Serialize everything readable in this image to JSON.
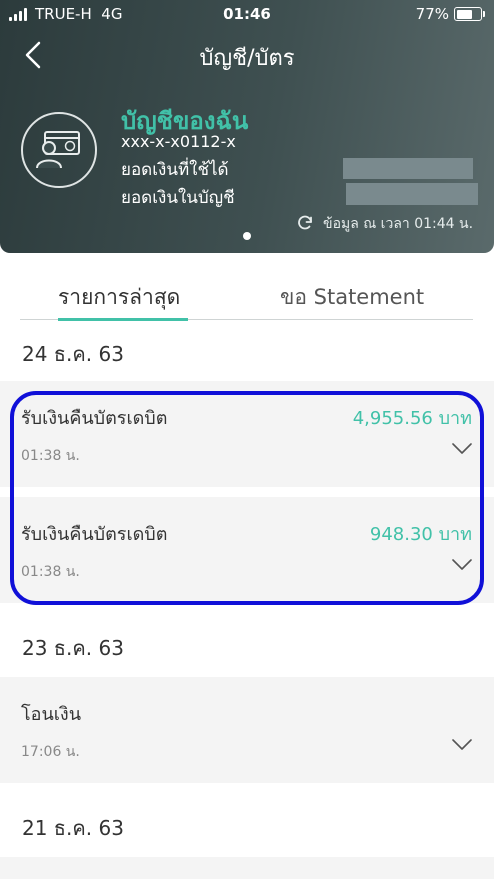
{
  "status_bar": {
    "carrier": "TRUE-H",
    "network": "4G",
    "time": "01:46",
    "battery_percent": "77%",
    "battery_level": 0.77
  },
  "header": {
    "title": "บัญชี/บัตร",
    "back_icon": "chevron-left-icon"
  },
  "account": {
    "name": "บัญชีของฉัน",
    "number": "xxx-x-x0112-x",
    "available_label": "ยอดเงินที่ใช้ได้",
    "balance_label": "ยอดเงินในบัญชี",
    "updated_at": "ข้อมูล ณ เวลา 01:44 น.",
    "icon": "account-card-user-icon"
  },
  "tabs": [
    {
      "label": "รายการล่าสุด",
      "active": true
    },
    {
      "label": "ขอ Statement",
      "active": false
    }
  ],
  "groups": [
    {
      "date": "24 ธ.ค. 63",
      "transactions": [
        {
          "name": "รับเงินคืนบัตรเดบิต",
          "amount": "4,955.56 บาท",
          "time": "01:38 น."
        },
        {
          "name": "รับเงินคืนบัตรเดบิต",
          "amount": "948.30 บาท",
          "time": "01:38 น."
        }
      ]
    },
    {
      "date": "23 ธ.ค. 63",
      "transactions": [
        {
          "name": "โอนเงิน",
          "amount": "",
          "time": "17:06 น."
        }
      ]
    },
    {
      "date": "21 ธ.ค. 63",
      "transactions": []
    }
  ],
  "colors": {
    "accent": "#41c1a8",
    "header_dark": "#2c3b3c",
    "highlight": "#1010d8"
  }
}
